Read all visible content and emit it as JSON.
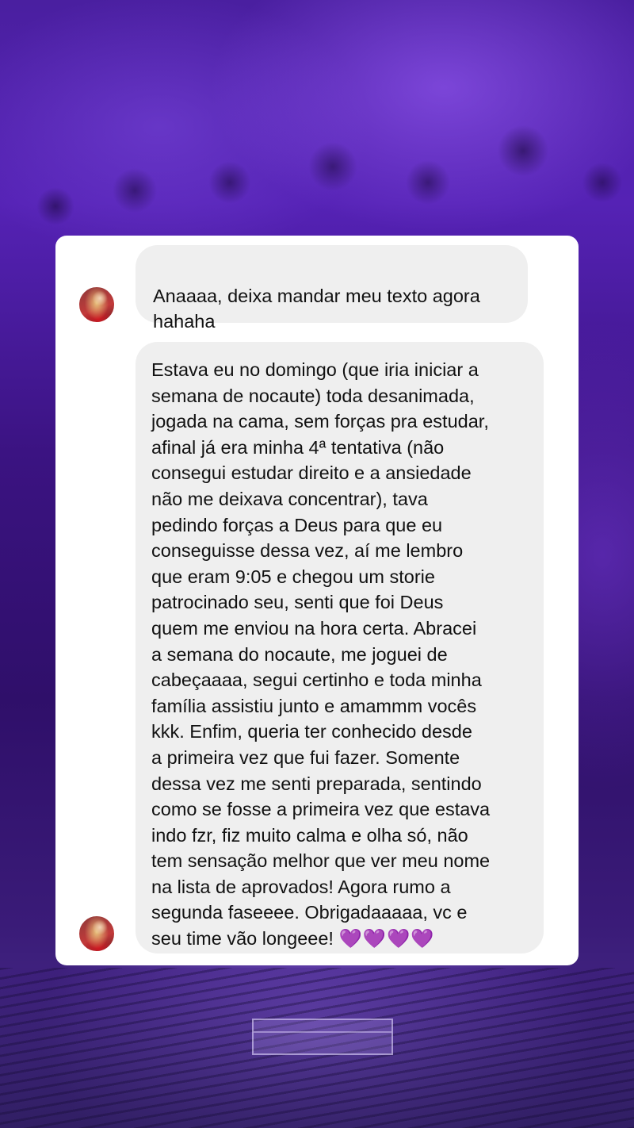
{
  "background": {
    "description_colors": {
      "primary": "#4a1fa0",
      "dark": "#2f0f6a"
    }
  },
  "chat": {
    "messages": [
      {
        "sender_avatar": "avatar",
        "text": "Anaaaa, deixa mandar meu texto agora\nhahaha"
      },
      {
        "sender_avatar": "avatar",
        "text": "Estava eu no domingo (que iria iniciar a\nsemana de nocaute) toda desanimada,\njogada na cama, sem forças pra estudar,\nafinal já era minha 4ª tentativa (não\nconsegui estudar direito e a ansiedade\nnão me deixava concentrar), tava\npedindo forças a Deus para que eu\nconseguisse dessa vez, aí me lembro\nque eram 9:05 e chegou um storie\npatrocinado seu, senti que foi Deus\nquem me enviou na hora certa. Abracei\na semana do nocaute, me joguei de\ncabeçaaaa, segui certinho e toda minha\nfamília assistiu junto e amammm vocês\nkkk. Enfim, queria ter conhecido desde\na primeira vez que fui fazer. Somente\ndessa vez me senti preparada, sentindo\ncomo se fosse a primeira vez que estava\nindo fzr, fiz muito calma e olha só, não\ntem sensação melhor que ver meu nome\nna lista de aprovados! Agora rumo a\nsegunda faseeee. Obrigadaaaaa, vc e\nseu time vão longeee! ",
        "emoji": "💜💜💜💜"
      }
    ]
  },
  "colors": {
    "card": "#ffffff",
    "bubble": "#efefef",
    "heart": "#a259f0"
  }
}
